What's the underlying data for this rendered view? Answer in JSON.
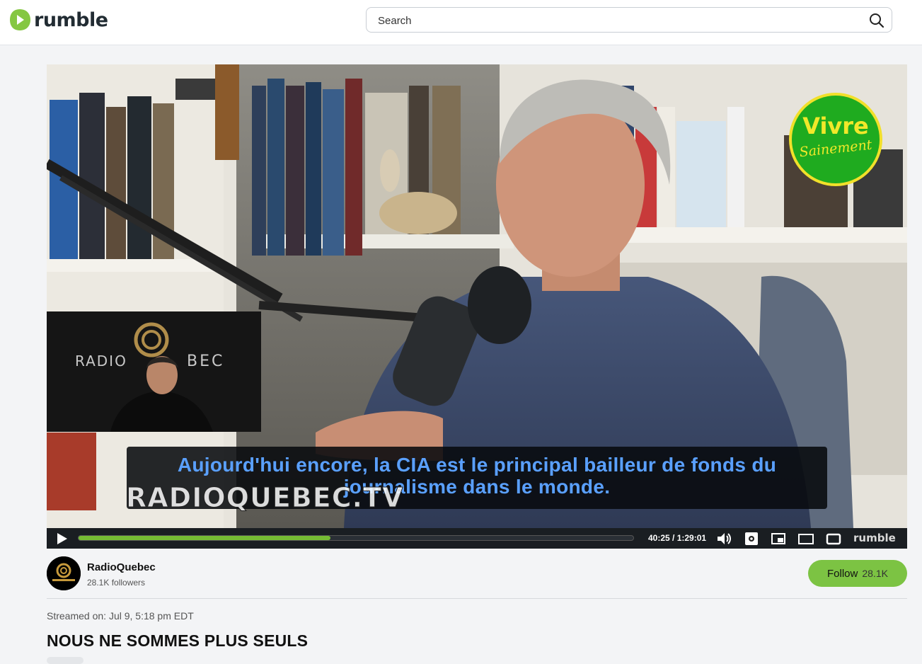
{
  "header": {
    "logo_text": "rumble",
    "search": {
      "placeholder": "Search",
      "value": ""
    },
    "icons": {
      "logo": "rumble-play-icon",
      "search": "search-icon"
    }
  },
  "video": {
    "subtitle_line1": "Aujourd'hui encore, la CIA est le principal bailleur de fonds du",
    "subtitle_line2": "journalisme dans le monde.",
    "watermark": "RADIOQUEBEC.TV",
    "overlay_badge_line1": "Vivre",
    "overlay_badge_line2": "Sainement",
    "pip_brand_left": "RADIO",
    "pip_brand_right": "BEC",
    "player": {
      "current_time": "40:25",
      "duration": "1:29:01",
      "time_display": "40:25 / 1:29:01",
      "progress_fraction": 0.4541,
      "brand": "rumble",
      "controls": [
        "play-icon",
        "volume-icon",
        "settings-icon",
        "pip-icon",
        "theater-icon",
        "fullscreen-icon"
      ]
    }
  },
  "channel": {
    "name": "RadioQuebec",
    "followers": "28.1K followers",
    "follow_label": "Follow",
    "follow_count": "28.1K"
  },
  "meta": {
    "streamed": "Streamed on: Jul 9, 5:18 pm EDT",
    "title": "NOUS NE SOMMES PLUS SEULS"
  },
  "colors": {
    "accent": "#75bb33",
    "follow_button": "#7cc343",
    "subtitle_text": "#5aa0ff",
    "page_bg": "#f3f4f6"
  }
}
